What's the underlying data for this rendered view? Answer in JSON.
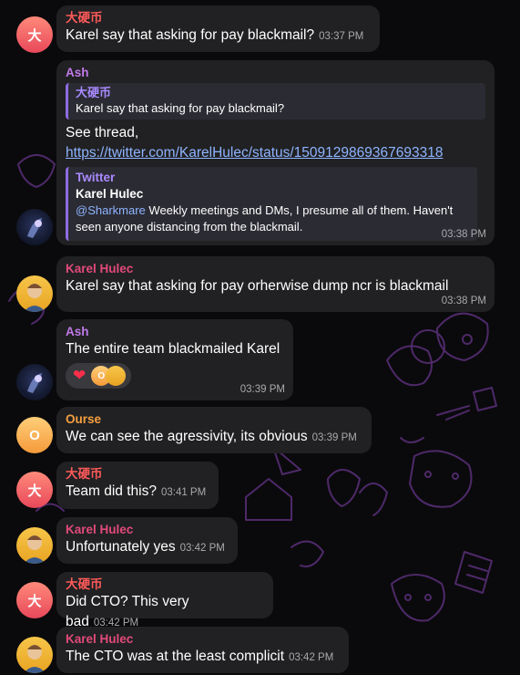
{
  "messages": [
    {
      "sender": "大硬币",
      "text": "Karel say that asking for pay blackmail?",
      "time": "03:37 PM"
    },
    {
      "sender": "Ash",
      "reply": {
        "name": "大硬币",
        "text": "Karel say that asking for pay blackmail?"
      },
      "text": "See thread,",
      "link": "https://twitter.com/KarelHulec/status/1509129869367693318",
      "preview": {
        "site": "Twitter",
        "title": "Karel Hulec",
        "mention": "@Sharkmare",
        "text": "Weekly meetings and DMs, I presume all of them. Haven't seen anyone distancing from the blackmail."
      },
      "time": "03:38 PM"
    },
    {
      "sender": "Karel Hulec",
      "text": "Karel say that asking for pay orherwise dump ncr is blackmail",
      "time": "03:38 PM"
    },
    {
      "sender": "Ash",
      "text": "The entire team blackmailed Karel",
      "reaction": {
        "emoji": "❤",
        "avatar_initial": "O"
      },
      "time": "03:39 PM"
    },
    {
      "sender": "Ourse",
      "text": "We can see the agressivity, its obvious",
      "time": "03:39 PM"
    },
    {
      "sender": "大硬币",
      "text": "Team did this?",
      "time": "03:41 PM"
    },
    {
      "sender": "Karel Hulec",
      "text": "Unfortunately yes",
      "time": "03:42 PM"
    },
    {
      "sender": "大硬币",
      "text": "Did CTO? This very bad",
      "time": "03:42 PM"
    },
    {
      "sender": "Karel Hulec",
      "text": "The CTO was at the least complicit",
      "time": "03:42 PM"
    }
  ],
  "avatars": {
    "da": "大",
    "ourse": "O"
  },
  "colors": {
    "background": "#0a0a0c",
    "bubble": "#212123",
    "link": "#8eb4ff",
    "quote_bar": "#8e6ce0",
    "wallpaper_lines": "#5a2f7a"
  }
}
